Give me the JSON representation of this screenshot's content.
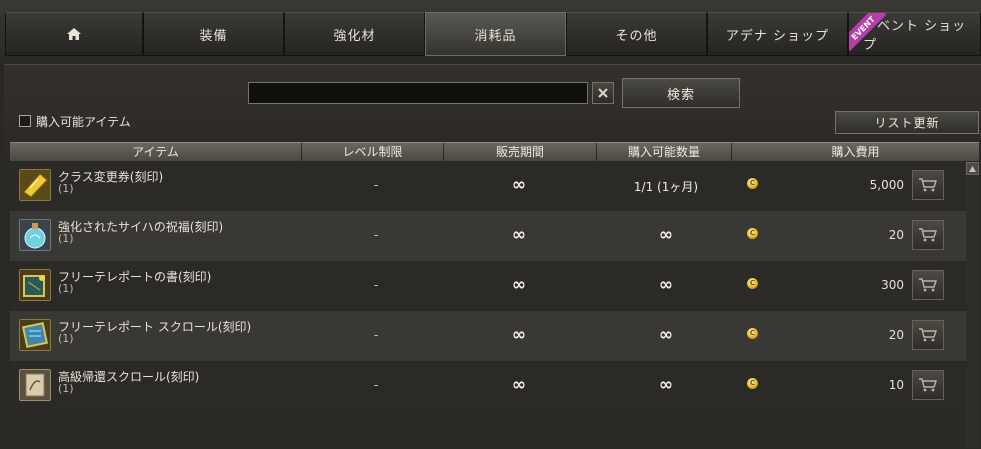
{
  "tabs": [
    {
      "label": "",
      "icon": "home-icon"
    },
    {
      "label": "装備"
    },
    {
      "label": "強化材"
    },
    {
      "label": "消耗品",
      "active": true
    },
    {
      "label": "その他"
    },
    {
      "label": "アデナ ショップ"
    },
    {
      "label": "イベント ショップ",
      "badge": "EVENT"
    }
  ],
  "search": {
    "value": "",
    "button_label": "検索"
  },
  "filter": {
    "checkbox_label": "購入可能アイテム",
    "checked": false
  },
  "refresh_label": "リスト更新",
  "columns": [
    "アイテム",
    "レベル制限",
    "販売期間",
    "購入可能数量",
    "購入費用"
  ],
  "items": [
    {
      "name": "クラス変更券(刻印)",
      "qty": "(1)",
      "level": "-",
      "period": "∞",
      "limit": "1/1 (1ヶ月)",
      "price": "5,000",
      "icon": "golden-ticket-icon"
    },
    {
      "name": "強化されたサイハの祝福(刻印)",
      "qty": "(1)",
      "level": "-",
      "period": "∞",
      "limit": "∞",
      "price": "20",
      "icon": "blue-potion-icon"
    },
    {
      "name": "フリーテレポートの書(刻印)",
      "qty": "(1)",
      "level": "-",
      "period": "∞",
      "limit": "∞",
      "price": "300",
      "icon": "teleport-book-icon"
    },
    {
      "name": "フリーテレポート スクロール(刻印)",
      "qty": "(1)",
      "level": "-",
      "period": "∞",
      "limit": "∞",
      "price": "20",
      "icon": "teleport-scroll-icon"
    },
    {
      "name": "高級帰還スクロール(刻印)",
      "qty": "(1)",
      "level": "-",
      "period": "∞",
      "limit": "∞",
      "price": "10",
      "icon": "return-scroll-icon"
    }
  ],
  "colors": {
    "coin": "#e2b628",
    "event_badge": "#b43fa8"
  }
}
